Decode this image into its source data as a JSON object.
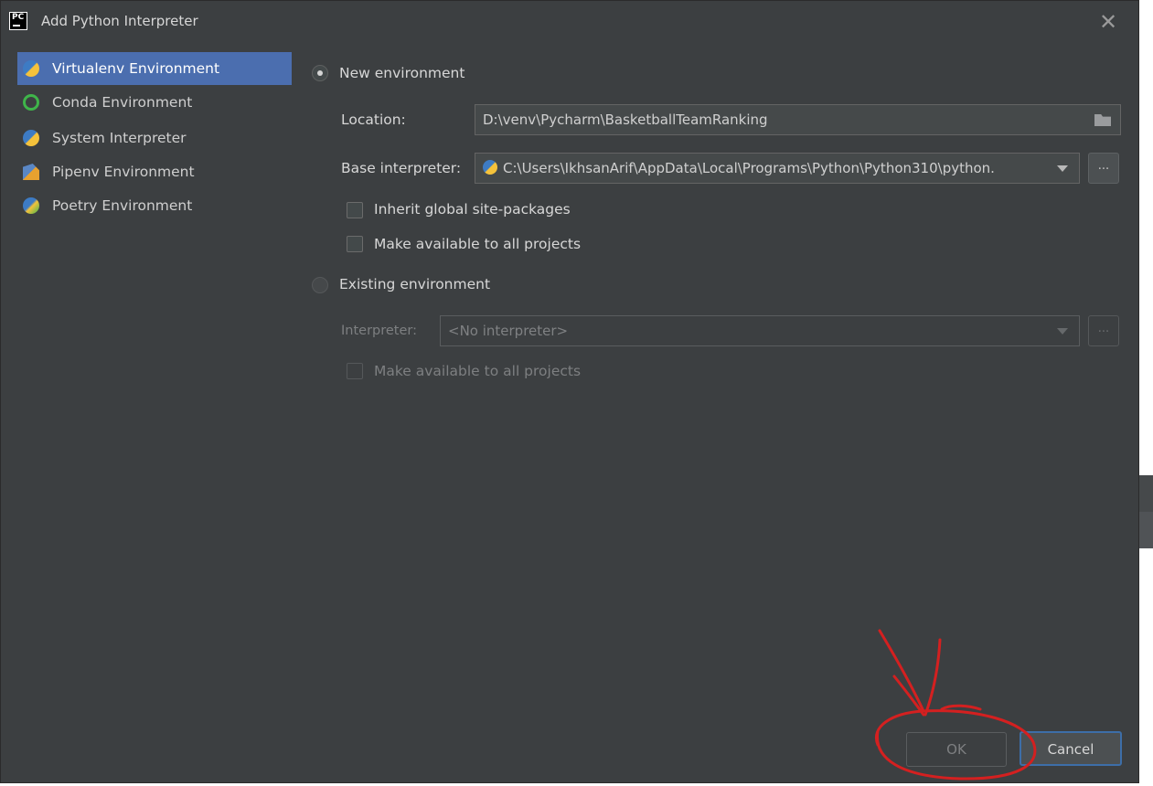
{
  "window": {
    "app_icon_text": "PC",
    "title": "Add Python Interpreter",
    "close_glyph": "✕"
  },
  "sidebar": {
    "items": [
      {
        "label": "Virtualenv Environment",
        "icon": "virtualenv-icon",
        "selected": true
      },
      {
        "label": "Conda Environment",
        "icon": "conda-icon",
        "selected": false
      },
      {
        "label": "System Interpreter",
        "icon": "python-icon",
        "selected": false
      },
      {
        "label": "Pipenv Environment",
        "icon": "pipenv-icon",
        "selected": false
      },
      {
        "label": "Poetry Environment",
        "icon": "poetry-icon",
        "selected": false
      }
    ]
  },
  "new_env": {
    "radio_label": "New environment",
    "selected": true,
    "location_label": "Location:",
    "location_value": "D:\\venv\\Pycharm\\BasketballTeamRanking",
    "base_interpreter_label": "Base interpreter:",
    "base_interpreter_value": "C:\\Users\\IkhsanArif\\AppData\\Local\\Programs\\Python\\Python310\\python.",
    "browse_label": "...",
    "inherit_label": "Inherit global site-packages",
    "inherit_checked": false,
    "make_available_label": "Make available to all projects",
    "make_available_checked": false
  },
  "existing_env": {
    "radio_label": "Existing environment",
    "selected": false,
    "interpreter_label": "Interpreter:",
    "interpreter_value": "<No interpreter>",
    "browse_label": "...",
    "make_available_label": "Make available to all projects",
    "make_available_checked": false
  },
  "buttons": {
    "ok": "OK",
    "cancel": "Cancel"
  },
  "colors": {
    "dialog_bg": "#3c3f41",
    "selection": "#4b6eaf",
    "annotation": "#d42020",
    "focus_border": "#3d6ea8"
  }
}
